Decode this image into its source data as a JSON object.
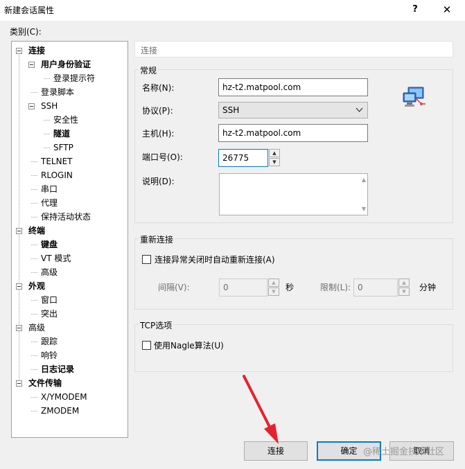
{
  "window": {
    "title": "新建会话属性",
    "help_glyph": "?",
    "close_glyph": "✕"
  },
  "category_label": "类别(C):",
  "tree": [
    {
      "label": "连接",
      "bold": true
    },
    {
      "label": "用户身份验证",
      "bold": true
    },
    {
      "label": "登录提示符",
      "bold": false
    },
    {
      "label": "登录脚本",
      "bold": false
    },
    {
      "label": "SSH",
      "bold": false
    },
    {
      "label": "安全性",
      "bold": false
    },
    {
      "label": "隧道",
      "bold": true
    },
    {
      "label": "SFTP",
      "bold": false
    },
    {
      "label": "TELNET",
      "bold": false
    },
    {
      "label": "RLOGIN",
      "bold": false
    },
    {
      "label": "串口",
      "bold": false
    },
    {
      "label": "代理",
      "bold": false
    },
    {
      "label": "保持活动状态",
      "bold": false
    },
    {
      "label": "终端",
      "bold": true
    },
    {
      "label": "键盘",
      "bold": true
    },
    {
      "label": "VT 模式",
      "bold": false
    },
    {
      "label": "高级",
      "bold": false
    },
    {
      "label": "外观",
      "bold": true
    },
    {
      "label": "窗口",
      "bold": false
    },
    {
      "label": "突出",
      "bold": false
    },
    {
      "label": "高级",
      "bold": false
    },
    {
      "label": "跟踪",
      "bold": false
    },
    {
      "label": "响铃",
      "bold": false
    },
    {
      "label": "日志记录",
      "bold": true
    },
    {
      "label": "文件传输",
      "bold": true
    },
    {
      "label": "X/YMODEM",
      "bold": false
    },
    {
      "label": "ZMODEM",
      "bold": false
    }
  ],
  "section_header": "连接",
  "general": {
    "title": "常规",
    "name_label": "名称(N):",
    "name_value": "hz-t2.matpool.com",
    "protocol_label": "协议(P):",
    "protocol_value": "SSH",
    "host_label": "主机(H):",
    "host_value": "hz-t2.matpool.com",
    "port_label": "端口号(O):",
    "port_value": "26775",
    "desc_label": "说明(D):",
    "desc_value": ""
  },
  "reconnect": {
    "title": "重新连接",
    "checkbox_label": "连接异常关闭时自动重新连接(A)",
    "checked": false,
    "interval_label": "间隔(V):",
    "interval_value": "0",
    "interval_unit": "秒",
    "limit_label": "限制(L):",
    "limit_value": "0",
    "limit_unit": "分钟"
  },
  "tcp": {
    "title": "TCP选项",
    "nagle_label": "使用Nagle算法(U)",
    "checked": false
  },
  "buttons": {
    "connect": "连接",
    "ok": "确定",
    "cancel": "取消"
  },
  "watermark": "@稀土掘金技术社区",
  "colors": {
    "accent": "#0078d7",
    "annotation_arrow": "#e8202a"
  }
}
